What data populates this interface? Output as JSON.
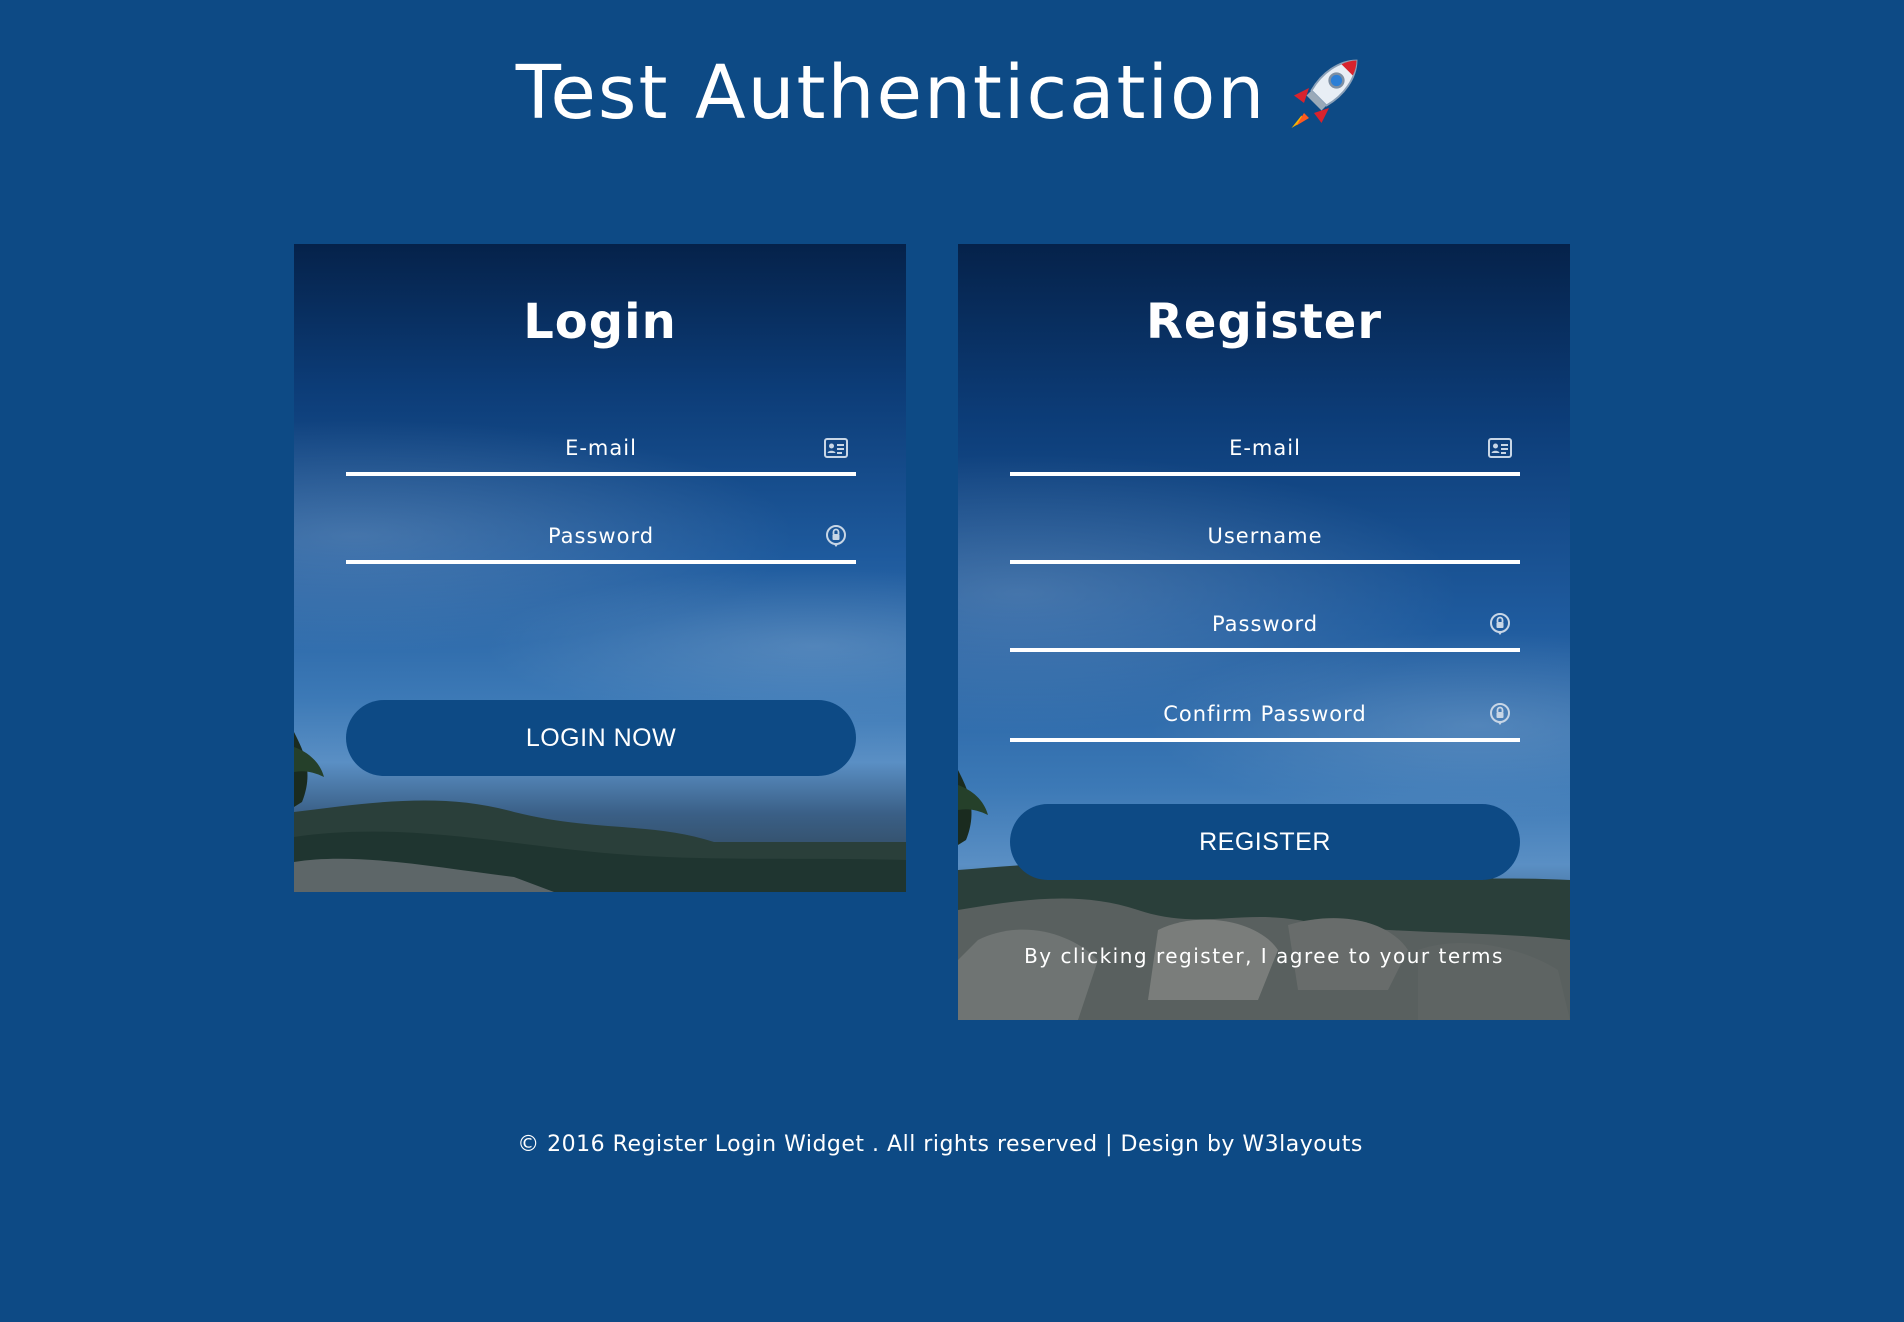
{
  "page": {
    "title": "Test Authentication",
    "title_icon": "rocket-icon"
  },
  "login": {
    "heading": "Login",
    "email_placeholder": "E-mail",
    "email_icon": "id-card-icon",
    "password_placeholder": "Password",
    "password_icon": "lock-icon",
    "submit_label": "LOGIN NOW"
  },
  "register": {
    "heading": "Register",
    "email_placeholder": "E-mail",
    "email_icon": "id-card-icon",
    "username_placeholder": "Username",
    "password_placeholder": "Password",
    "password_icon": "lock-icon",
    "confirm_placeholder": "Confirm Password",
    "confirm_icon": "lock-icon",
    "submit_label": "REGISTER",
    "terms_text": "By clicking register, I agree to your terms"
  },
  "footer": {
    "text": "© 2016 Register Login Widget . All rights reserved | Design by W3layouts"
  },
  "colors": {
    "background": "#0d4a85",
    "button": "#0d4a85",
    "text": "#ffffff"
  }
}
